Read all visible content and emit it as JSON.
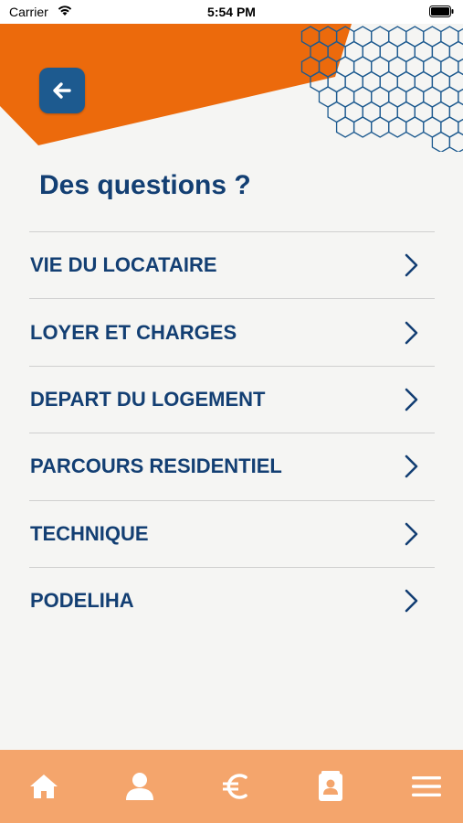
{
  "status_bar": {
    "carrier": "Carrier",
    "time": "5:54 PM"
  },
  "colors": {
    "accent_orange": "#ec6a0c",
    "tab_bar": "#f4a56c",
    "primary_blue": "#133f73",
    "back_button": "#1d5a8f",
    "background": "#f5f5f3"
  },
  "header": {
    "back_icon": "arrow-left-icon",
    "decoration": "hexagon-pattern"
  },
  "page": {
    "title": "Des questions ?"
  },
  "faq": {
    "items": [
      {
        "label": "VIE DU LOCATAIRE"
      },
      {
        "label": "LOYER ET CHARGES"
      },
      {
        "label": "DEPART DU LOGEMENT"
      },
      {
        "label": "PARCOURS RESIDENTIEL"
      },
      {
        "label": "TECHNIQUE"
      },
      {
        "label": "PODELIHA"
      }
    ],
    "chevron_icon": "chevron-right-icon"
  },
  "tab_bar": {
    "tabs": [
      {
        "icon": "home-icon",
        "active": true
      },
      {
        "icon": "user-icon",
        "active": false
      },
      {
        "icon": "euro-icon",
        "active": false
      },
      {
        "icon": "contact-card-icon",
        "active": false
      },
      {
        "icon": "menu-icon",
        "active": false
      }
    ]
  }
}
